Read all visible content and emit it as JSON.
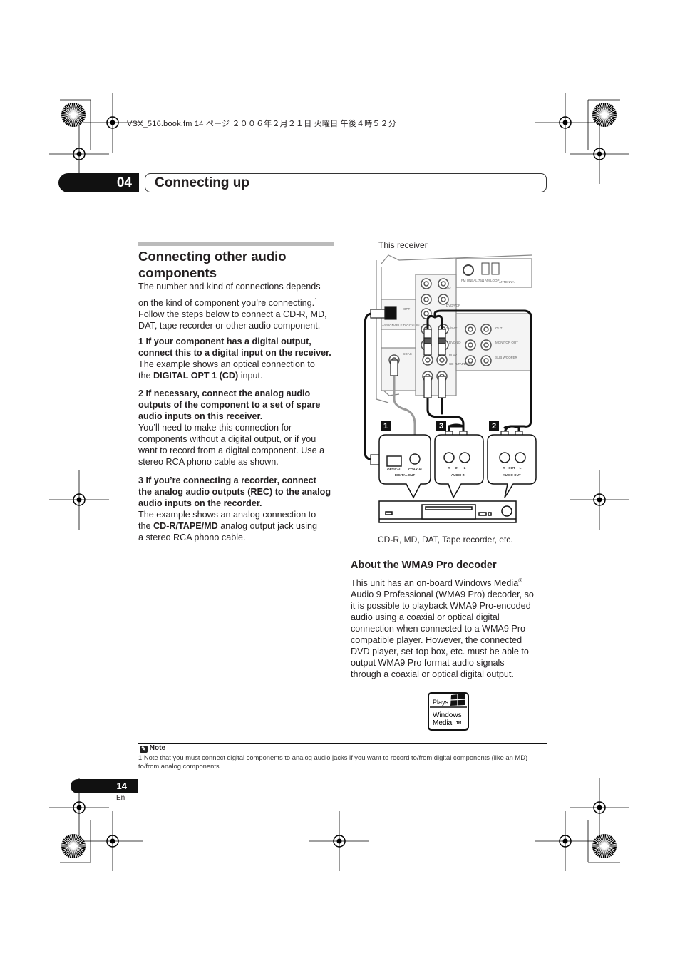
{
  "file_header": "VSX_516.book.fm  14 ページ  ２００６年２月２１日  火曜日  午後４時５２分",
  "chapter": {
    "number": "04",
    "title": "Connecting up"
  },
  "left": {
    "heading": "Connecting other audio components",
    "intro": [
      "The number and kind of connections depends",
      "on the kind of component you’re connecting.",
      "Follow the steps below to connect a CD-R, MD,",
      "DAT, tape recorder or other audio component."
    ],
    "footnote_ref": "1",
    "step1_title": [
      "1    If your component has a digital output,",
      "connect this to a digital input on the receiver."
    ],
    "step1_body": [
      "The example shows an optical connection to",
      "the "
    ],
    "step1_bold": "DIGITAL OPT 1 (CD)",
    "step1_tail": " input.",
    "step2_title": [
      "2    If necessary, connect the analog audio",
      "outputs of the component to a set of spare",
      "audio inputs on this receiver."
    ],
    "step2_body": [
      "You’ll need to make this connection for",
      "components without a digital output, or if you",
      "want to record from a digital component. Use a",
      "stereo RCA phono cable as shown."
    ],
    "step3_title": [
      "3    If you’re connecting a recorder, connect",
      "the analog audio outputs (REC) to the analog",
      "audio inputs on the recorder."
    ],
    "step3_body": [
      "The example shows an analog connection to",
      "the "
    ],
    "step3_bold": "CD-R/TAPE/MD",
    "step3_tail": " analog output jack using",
    "step3_end": "a stereo RCA phono cable."
  },
  "diagram": {
    "top_label": "This receiver",
    "bottom_label": "CD-R, MD, DAT, Tape recorder, etc.",
    "callouts": [
      "1",
      "3",
      "2"
    ],
    "receiver_labels": {
      "opt": "OPT",
      "cd": "CD",
      "dvd": "DVD/VCR",
      "tv": "TV/SAT",
      "dvdld": "DVD/LD",
      "play": "PLAY",
      "cdr": "CD-R/TAPE/MD",
      "coax": "COAX",
      "fm": "FM UNBAL 75Ω",
      "am": "AM LOOP",
      "antenna": "ANTENNA",
      "in": "IN",
      "out": "OUT",
      "monitor": "MONITOR OUT",
      "sub": "SUB WOOFER",
      "digital_in": "ASSIGNABLE DIGITAL IN"
    },
    "component_labels": {
      "optical": "OPTICAL",
      "coaxial": "COAXIAL",
      "digital_out": "DIGITAL OUT",
      "audio_in": "AUDIO IN",
      "audio_out": "AUDIO OUT",
      "r": "R",
      "l": "L",
      "in": "IN",
      "out": "OUT"
    }
  },
  "wma": {
    "heading": "About the WMA9 Pro decoder",
    "lines": [
      "This unit has an on-board Windows Media",
      "Audio 9 Professional (WMA9 Pro) decoder, so",
      "it is possible to playback WMA9 Pro-encoded",
      "audio using a coaxial or optical digital",
      "connection when connected to a WMA9 Pro-",
      "compatible player. However, the connected",
      "DVD player, set-top box, etc. must be able to",
      "output WMA9 Pro format audio signals",
      "through a coaxial or optical digital output."
    ],
    "reg": "®",
    "logo": {
      "plays": "Plays",
      "windows": "Windows",
      "media": "Media",
      "tm": "TM"
    }
  },
  "note": {
    "heading": "Note",
    "text": "1 Note that you must connect digital components to analog audio jacks if you want to record to/from digital components (like an MD) to/from analog components."
  },
  "page": {
    "number": "14",
    "lang": "En"
  }
}
